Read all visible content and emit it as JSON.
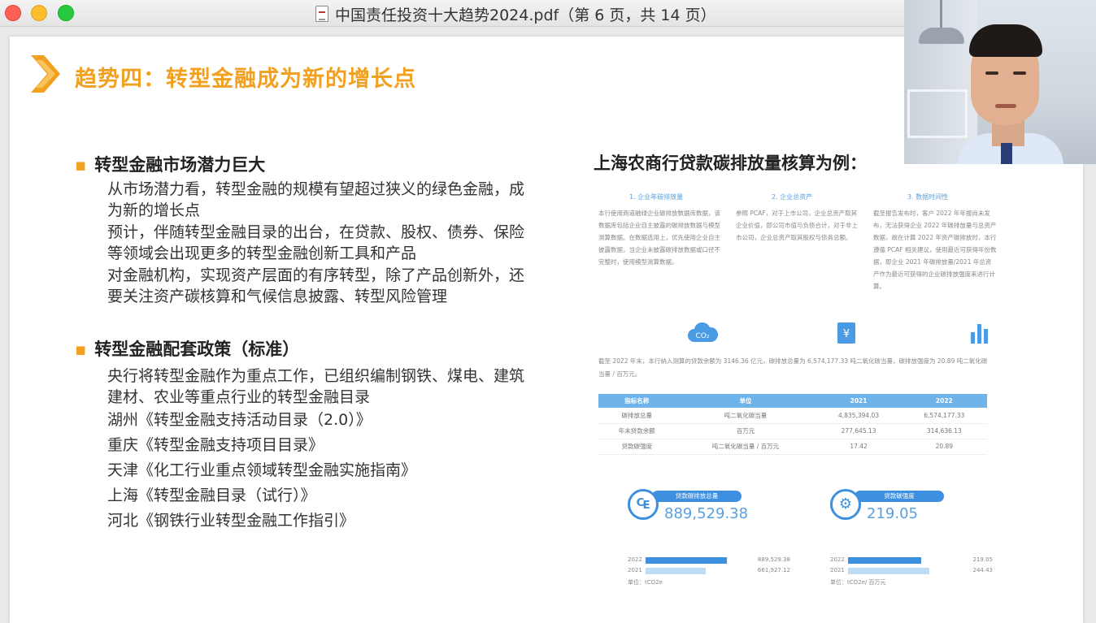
{
  "window": {
    "title": "中国责任投资十大趋势2024.pdf（第 6 页，共 14 页）",
    "file_icon": "pdf-file-icon"
  },
  "slide": {
    "heading": "趋势四：转型金融成为新的增长点",
    "section1": {
      "title": "转型金融市场潜力巨大",
      "paragraphs": [
        "从市场潜力看，转型金融的规模有望超过狭义的绿色金融，成为新的增长点",
        "预计，伴随转型金融目录的出台，在贷款、股权、债券、保险等领域会出现更多的转型金融创新工具和产品",
        "对金融机构，实现资产层面的有序转型，除了产品创新外，还要关注资产碳核算和气候信息披露、转型风险管理"
      ]
    },
    "section2": {
      "title": "转型金融配套政策（标准）",
      "items": [
        "央行将转型金融作为重点工作，已组织编制钢铁、煤电、建筑建材、农业等重点行业的转型金融目录",
        "湖州《转型金融支持活动目录（2.0）》",
        "重庆《转型金融支持项目目录》",
        "天津《化工行业重点领域转型金融实施指南》",
        "上海《转型金融目录（试行）》",
        "河北《钢铁行业转型金融工作指引》"
      ]
    },
    "case": {
      "title": "上海农商行贷款碳排放量核算为例：",
      "columns": [
        {
          "header": "1. 企业年碳排放量",
          "text": "本行使用商道融绿企业碳排放数据库数据，该数据库包括企业自主披露的碳排放数据与模型测算数据。在数据选用上，优先使用企业自主披露数据，当企业未披露碳排放数据或口径不完整时，使用模型测算数据。"
        },
        {
          "header": "2. 企业总资产",
          "text": "参照 PCAF，对于上市公司，企业总资产取其企业价值，即公司市值与负债合计，对于非上市公司，企业总资产取其股权与债务总额。"
        },
        {
          "header": "3. 数据时间性",
          "text": "截至报告发布时，客户 2022 年年报尚未发布，无法获得企业 2022 年碳排放量与总资产数据，故在计算 2022 年资产碳排放时，本行遵循 PCAF 相关建议，使用最近可获得年份数据，即企业 2021 年碳排放量/2021 年总资产作为最近可获得的企业碳排放强度来进行计算。"
        }
      ],
      "icons": [
        "co2-cloud-icon",
        "yuan-document-icon",
        "bar-chart-icon"
      ],
      "icon_text": "CO₂",
      "summary": "截至 2022 年末，本行纳入测算的贷款余额为 3146.36 亿元，碳排放总量为 6,574,177.33 吨二氧化碳当量，碳排放强度为 20.89 吨二氧化碳当量 / 百万元。",
      "table": {
        "headers": [
          "指标名称",
          "单位",
          "2021",
          "2022"
        ],
        "rows": [
          [
            "碳排放总量",
            "吨二氧化碳当量",
            "4,835,394.03",
            "6,574,177.33"
          ],
          [
            "年末贷款余额",
            "百万元",
            "277,645.13",
            "314,636.13"
          ],
          [
            "贷款碳强度",
            "吨二氧化碳当量 / 百万元",
            "17.42",
            "20.89"
          ]
        ]
      },
      "cards": [
        {
          "badge": "贷款碳排放总量",
          "icon": "leaf-icon",
          "glyph": "₠",
          "value": "889,529.38",
          "bars": [
            {
              "year": "2022",
              "value": "889,529.38",
              "fraction": 1.0
            },
            {
              "year": "2021",
              "value": "661,927.12",
              "fraction": 0.744
            }
          ],
          "unit": "单位：tCO2e"
        },
        {
          "badge": "贷款碳强度",
          "icon": "gear-leaf-icon",
          "glyph": "⚙",
          "value": "219.05",
          "bars": [
            {
              "year": "2022",
              "value": "219.05",
              "fraction": 0.896
            },
            {
              "year": "2021",
              "value": "244.43",
              "fraction": 1.0
            }
          ],
          "unit": "单位：tCO2e/ 百万元"
        }
      ],
      "colors": {
        "accent": "#f2a01f",
        "blue": "#3d8fe0",
        "light_blue": "#bfdcf5"
      }
    }
  }
}
